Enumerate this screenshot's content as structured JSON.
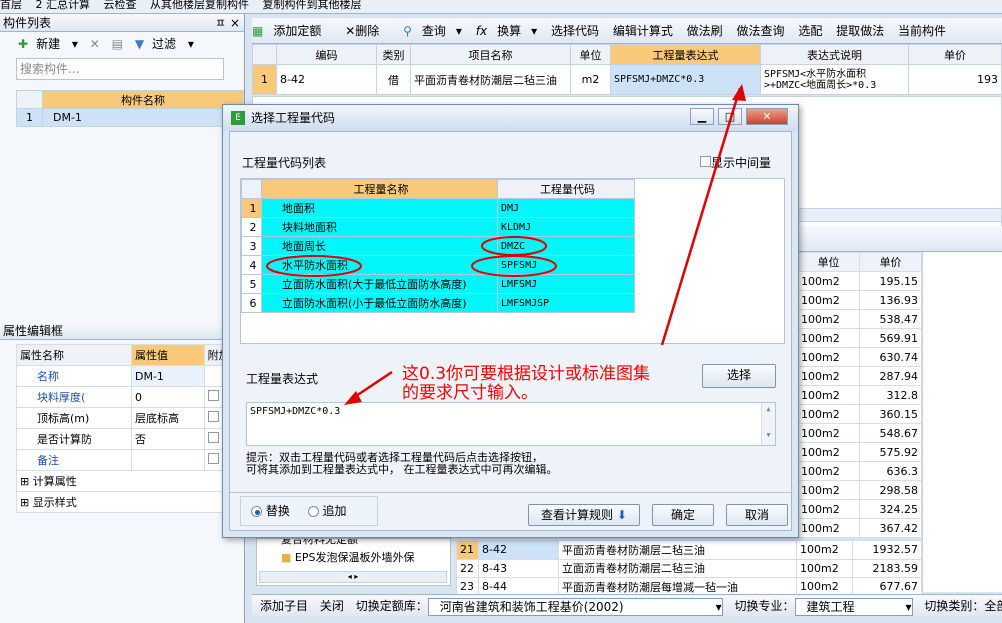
{
  "topbar": {
    "left_text": "首层",
    "items": [
      "2 汇总计算",
      "云检查",
      "从其他楼层复制构件",
      "复制构件到其他楼层"
    ]
  },
  "left": {
    "panel_title": "构件列表",
    "pin": "ㅍ",
    "close": "×",
    "toolbar": {
      "new": "新建",
      "delete_icon": "✕",
      "copy_icon": "▤",
      "filter": "过滤"
    },
    "search_placeholder": "搜索构件...",
    "list_header": "构件名称",
    "rows": [
      {
        "num": "1",
        "name": "DM-1"
      }
    ],
    "attr_title": "属性编辑框",
    "attr_headers": [
      "属性名称",
      "属性值",
      "附加"
    ],
    "attrs": [
      {
        "name": "名称",
        "value": "DM-1"
      },
      {
        "name": "块料厚度(",
        "value": "0"
      },
      {
        "name": "顶标高(m)",
        "value": "层底标高"
      },
      {
        "name": "是否计算防",
        "value": "否"
      },
      {
        "name": "备注",
        "value": ""
      }
    ],
    "expand": [
      "计算属性",
      "显示样式"
    ]
  },
  "main": {
    "toolbar": [
      "添加定额",
      "删除",
      "查询",
      "换算",
      "选择代码",
      "编辑计算式",
      "做法刷",
      "做法查询",
      "选配",
      "提取做法",
      "当前构件"
    ],
    "headers": [
      "编码",
      "类别",
      "项目名称",
      "单位",
      "工程量表达式",
      "表达式说明",
      "单价"
    ],
    "row": {
      "num": "1",
      "code": "8-42",
      "type": "借",
      "name": "平面沥青卷材防潮层二毡三油",
      "unit": "m2",
      "expr": "SPFSMJ+DMZC*0.3",
      "desc": "SPFSMJ<水平防水面积>+DMZC<地面周长>*0.3",
      "price": "193"
    }
  },
  "bottom_grid": {
    "headers": [
      "单位",
      "单价"
    ],
    "rows": [
      [
        "100m2",
        "195.15"
      ],
      [
        "100m2",
        "136.93"
      ],
      [
        "100m2",
        "538.47"
      ],
      [
        "100m2",
        "569.91"
      ],
      [
        "100m2",
        "630.74"
      ],
      [
        "100m2",
        "287.94"
      ],
      [
        "100m2",
        "312.8"
      ],
      [
        "100m2",
        "360.15"
      ],
      [
        "100m2",
        "548.67"
      ],
      [
        "100m2",
        "575.92"
      ],
      [
        "100m2",
        "636.3"
      ],
      [
        "100m2",
        "298.58"
      ],
      [
        "100m2",
        "324.25"
      ],
      [
        "100m2",
        "367.42"
      ]
    ],
    "tail": [
      [
        "21",
        "8-42",
        "平面沥青卷材防潮层二毡三油",
        "100m2",
        "1932.57"
      ],
      [
        "22",
        "8-43",
        "立面沥青卷材防潮层二毡三油",
        "100m2",
        "2183.59"
      ],
      [
        "23",
        "8-44",
        "平面沥青卷材防潮层每增减一毡一油",
        "100m2",
        "677.67"
      ]
    ],
    "tree_label": "EPS发泡保温板外墙外保",
    "tree_label2": "复合材料无定额"
  },
  "status": {
    "add_child": "添加子目",
    "close": "关闭",
    "switch_lib": "切换定额库：",
    "lib": "河南省建筑和装饰工程基价(2002)",
    "switch_major": "切换专业：",
    "major": "建筑工程",
    "switch_type": "切换类别：",
    "type": "全部"
  },
  "dialog": {
    "title": "选择工程量代码",
    "icon_text": "E",
    "list_label": "工程量代码列表",
    "show_middle": "显示中间量",
    "col_name": "工程量名称",
    "col_code": "工程量代码",
    "rows": [
      {
        "num": "1",
        "name": "地面积",
        "code": "DMJ"
      },
      {
        "num": "2",
        "name": "块料地面积",
        "code": "KLDMJ"
      },
      {
        "num": "3",
        "name": "地面周长",
        "code": "DMZC"
      },
      {
        "num": "4",
        "name": "水平防水面积",
        "code": "SPFSMJ"
      },
      {
        "num": "5",
        "name": "立面防水面积(大于最低立面防水高度)",
        "code": "LMFSMJ"
      },
      {
        "num": "6",
        "name": "立面防水面积(小于最低立面防水高度)",
        "code": "LMFSMJSP"
      }
    ],
    "expr_label": "工程量表达式",
    "select_btn": "选择",
    "expr_value": "SPFSMJ+DMZC*0.3",
    "hint1": "提示：双击工程量代码或者选择工程量代码后点击选择按钮，",
    "hint2": "可将其添加到工程量表达式中， 在工程量表达式中可再次编辑。",
    "replace": "替换",
    "append": "追加",
    "view_rules": "查看计算规则",
    "ok": "确定",
    "cancel": "取消"
  },
  "annotation": {
    "line1": "这0.3你可要根据设计或标准图集",
    "line2": "的要求尺寸输入。",
    "color": "#ff0000"
  }
}
